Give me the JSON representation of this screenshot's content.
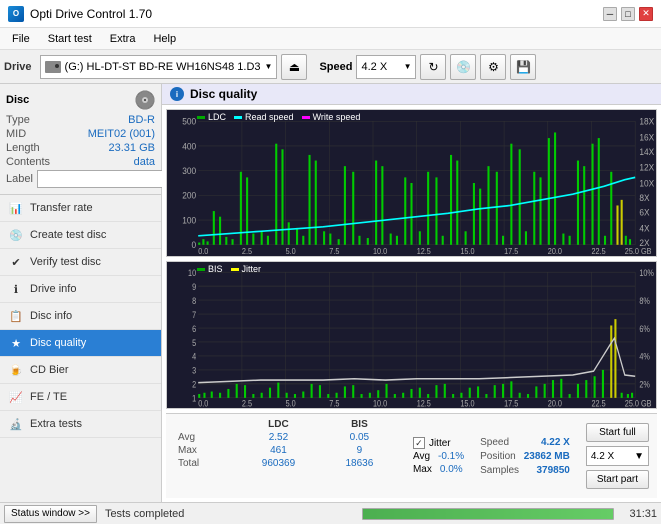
{
  "app": {
    "title": "Opti Drive Control 1.70",
    "icon": "O"
  },
  "titlebar": {
    "minimize": "─",
    "maximize": "□",
    "close": "✕"
  },
  "menu": {
    "items": [
      "File",
      "Start test",
      "Extra",
      "Help"
    ]
  },
  "toolbar": {
    "drive_label": "Drive",
    "drive_name": "(G:)  HL-DT-ST BD-RE  WH16NS48 1.D3",
    "speed_label": "Speed",
    "speed_value": "4.2 X"
  },
  "disc": {
    "section_label": "Disc",
    "type_label": "Type",
    "type_value": "BD-R",
    "mid_label": "MID",
    "mid_value": "MEIT02 (001)",
    "length_label": "Length",
    "length_value": "23.31 GB",
    "contents_label": "Contents",
    "contents_value": "data",
    "label_label": "Label"
  },
  "nav": {
    "items": [
      {
        "id": "transfer-rate",
        "label": "Transfer rate",
        "icon": "📊"
      },
      {
        "id": "create-test-disc",
        "label": "Create test disc",
        "icon": "💿"
      },
      {
        "id": "verify-test-disc",
        "label": "Verify test disc",
        "icon": "✔"
      },
      {
        "id": "drive-info",
        "label": "Drive info",
        "icon": "ℹ"
      },
      {
        "id": "disc-info",
        "label": "Disc info",
        "icon": "📋"
      },
      {
        "id": "disc-quality",
        "label": "Disc quality",
        "icon": "★",
        "active": true
      },
      {
        "id": "cd-bier",
        "label": "CD Bier",
        "icon": "🍺"
      },
      {
        "id": "fe-te",
        "label": "FE / TE",
        "icon": "📈"
      },
      {
        "id": "extra-tests",
        "label": "Extra tests",
        "icon": "🔬"
      }
    ]
  },
  "disc_quality": {
    "title": "Disc quality",
    "icon": "i",
    "legend": {
      "ldc_label": "LDC",
      "ldc_color": "#00aa00",
      "read_speed_label": "Read speed",
      "read_speed_color": "#00ffff",
      "write_speed_label": "Write speed",
      "write_speed_color": "#ff00ff"
    },
    "top_chart": {
      "y_axis_left": [
        "500",
        "400",
        "300",
        "200",
        "100",
        "0"
      ],
      "y_axis_right": [
        "18X",
        "16X",
        "14X",
        "12X",
        "10X",
        "8X",
        "6X",
        "4X",
        "2X"
      ],
      "x_axis": [
        "0.0",
        "2.5",
        "5.0",
        "7.5",
        "10.0",
        "12.5",
        "15.0",
        "17.5",
        "20.0",
        "22.5",
        "25.0 GB"
      ]
    },
    "bottom_chart": {
      "legend_bis": "BIS",
      "legend_jitter": "Jitter",
      "y_axis_left": [
        "10",
        "9",
        "8",
        "7",
        "6",
        "5",
        "4",
        "3",
        "2",
        "1"
      ],
      "y_axis_right": [
        "10%",
        "8%",
        "6%",
        "4%",
        "2%"
      ],
      "x_axis": [
        "0.0",
        "2.5",
        "5.0",
        "7.5",
        "10.0",
        "12.5",
        "15.0",
        "17.5",
        "20.0",
        "22.5",
        "25.0 GB"
      ]
    }
  },
  "stats": {
    "columns": [
      "LDC",
      "BIS"
    ],
    "rows": [
      {
        "label": "Avg",
        "ldc": "2.52",
        "bis": "0.05"
      },
      {
        "label": "Max",
        "ldc": "461",
        "bis": "9"
      },
      {
        "label": "Total",
        "ldc": "960369",
        "bis": "18636"
      }
    ],
    "jitter": {
      "label": "Jitter",
      "checked": true,
      "avg": "-0.1%",
      "max": "0.0%"
    },
    "speed": {
      "speed_label": "Speed",
      "speed_value": "4.22 X",
      "position_label": "Position",
      "position_value": "23862 MB",
      "samples_label": "Samples",
      "samples_value": "379850"
    },
    "buttons": {
      "start_full": "Start full",
      "start_part": "Start part",
      "speed_select": "4.2 X"
    }
  },
  "statusbar": {
    "status_btn_label": "Status window >>",
    "status_text": "Tests completed",
    "progress": 100,
    "time": "31:31"
  }
}
